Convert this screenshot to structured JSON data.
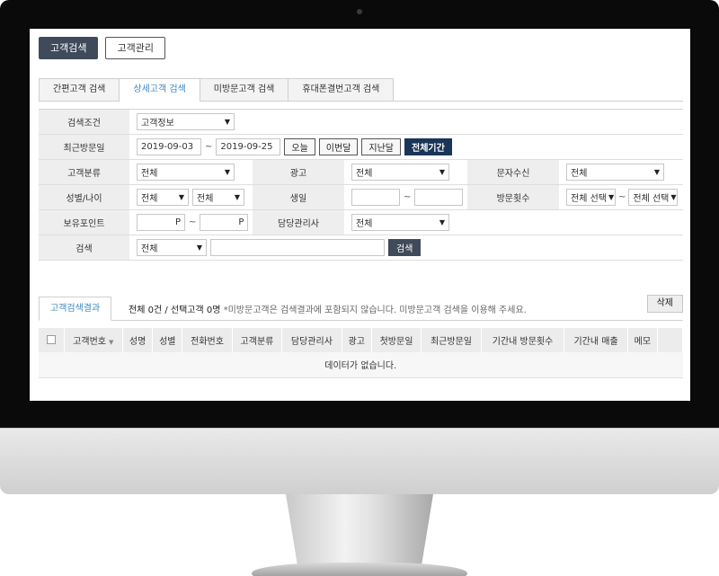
{
  "top_tabs": [
    {
      "label": "고객검색",
      "active": true
    },
    {
      "label": "고객관리",
      "active": false
    }
  ],
  "sub_tabs": [
    {
      "label": "간편고객 검색",
      "active": false
    },
    {
      "label": "상세고객 검색",
      "active": true
    },
    {
      "label": "미방문고객 검색",
      "active": false
    },
    {
      "label": "휴대폰결번고객 검색",
      "active": false
    }
  ],
  "form": {
    "search_condition": {
      "label": "검색조건",
      "value": "고객정보"
    },
    "recent_visit": {
      "label": "최근방문일",
      "from": "2019-09-03",
      "to": "2019-09-25",
      "tilde": "~",
      "presets": [
        "오늘",
        "이번달",
        "지난달",
        "전체기간"
      ]
    },
    "customer_type": {
      "label": "고객분류",
      "value": "전체"
    },
    "ad": {
      "label": "광고",
      "value": "전체"
    },
    "sms": {
      "label": "문자수신",
      "value": "전체"
    },
    "gender_age": {
      "label": "성별/나이",
      "gender": "전체",
      "age": "전체"
    },
    "birthday": {
      "label": "생일",
      "tilde": "~"
    },
    "visit_count": {
      "label": "방문횟수",
      "from": "전체 선택",
      "to": "전체 선택"
    },
    "points": {
      "label": "보유포인트",
      "unit": "P",
      "tilde": "~"
    },
    "manager": {
      "label": "담당관리사",
      "value": "전체"
    },
    "search": {
      "label": "검색",
      "field": "전체",
      "button": "검색"
    }
  },
  "result": {
    "tab_label": "고객검색결과",
    "summary": "전체 0건 / 선택고객 0명",
    "note": "*미방문고객은 검색결과에 포함되지 않습니다. 미방문고객 검색을 이용해 주세요.",
    "delete_label": "삭제",
    "columns": [
      "고객번호",
      "성명",
      "성별",
      "전화번호",
      "고객분류",
      "담당관리사",
      "광고",
      "첫방문일",
      "최근방문일",
      "기간내 방문횟수",
      "기간내 매출",
      "메모"
    ],
    "empty_message": "데이터가 없습니다."
  },
  "colors": {
    "active_tab": "#3f4b5a",
    "accent_text": "#3a87c2",
    "all_period_button": "#1b3558"
  }
}
